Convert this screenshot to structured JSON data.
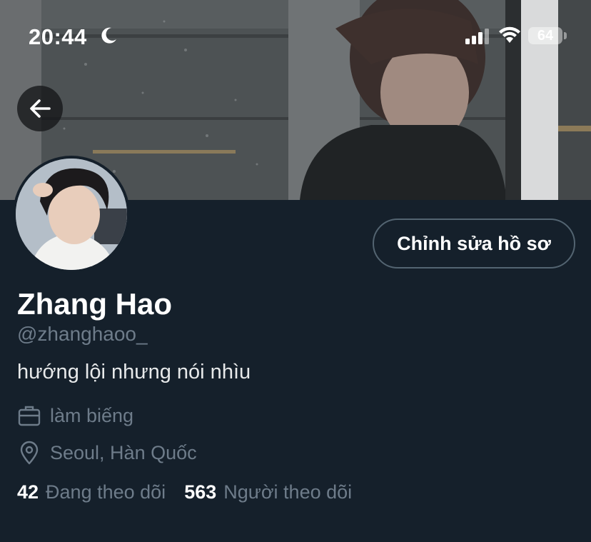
{
  "status_bar": {
    "time": "20:44",
    "battery": "64",
    "icons": [
      "moon-icon",
      "cellular-signal-icon",
      "wifi-icon",
      "battery-icon"
    ]
  },
  "header": {
    "back_icon": "arrow-left-icon"
  },
  "profile": {
    "edit_button_label": "Chỉnh sửa hồ sơ",
    "display_name": "Zhang Hao",
    "handle": "@zhanghaoo_",
    "bio": "hướng lội nhưng nói nhìu",
    "job": "làm biếng",
    "location": "Seoul, Hàn Quốc",
    "following_count": "42",
    "following_label": "Đang theo dõi",
    "followers_count": "563",
    "followers_label": "Người theo dõi"
  },
  "colors": {
    "background": "#15202b",
    "secondary_text": "#6e7c8a",
    "button_border": "#536471"
  }
}
